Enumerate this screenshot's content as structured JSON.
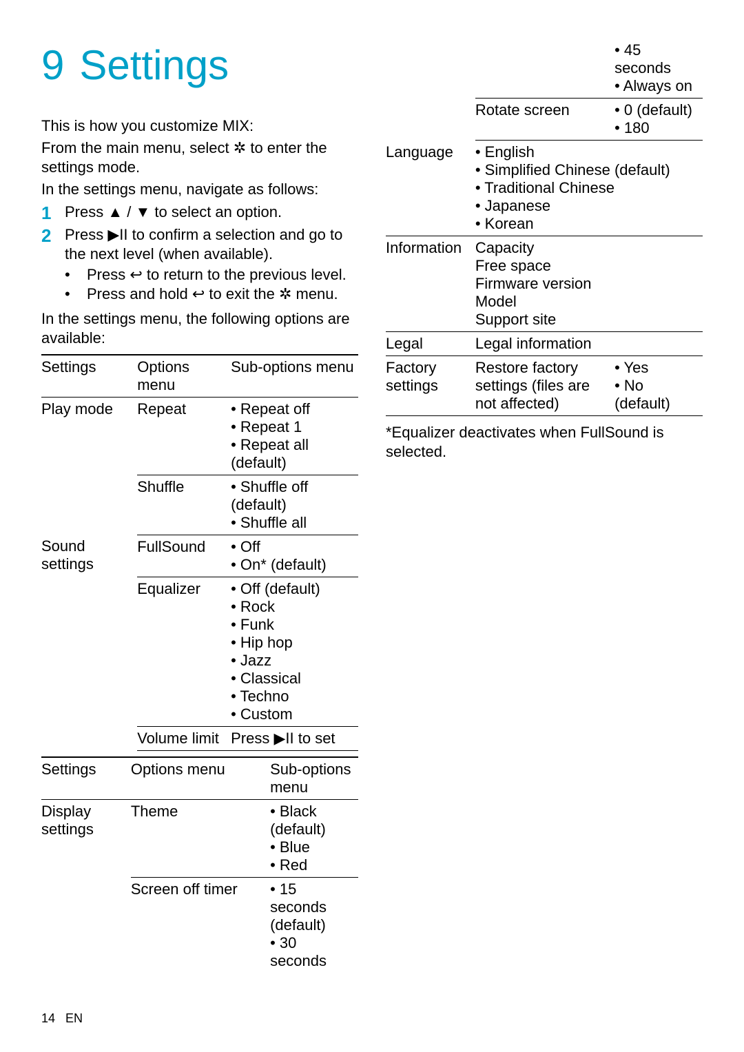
{
  "chapter_number": "9",
  "chapter_title": "Settings",
  "intro_line1": "This is how you customize MIX:",
  "intro_line2a": "From the main menu, select ",
  "intro_line2b": " to enter the settings mode.",
  "intro_line3": "In the settings menu, navigate as follows:",
  "step1_a": "Press ",
  "step1_b": " / ",
  "step1_c": " to select an option.",
  "step2_a": "Press ",
  "step2_b": " to confirm a selection and go to the next level (when available).",
  "sub1_a": "Press ",
  "sub1_b": " to return to the previous level.",
  "sub2_a": "Press and hold ",
  "sub2_b": " to exit the ",
  "sub2_c": " menu.",
  "avail_text": "In the settings menu, the following options are available:",
  "hdr_settings": "Settings",
  "hdr_options": "Options menu",
  "hdr_subopt": "Sub-options menu",
  "t1": {
    "play_mode": "Play mode",
    "repeat": "Repeat",
    "repeat_opts": [
      "Repeat off",
      "Repeat 1",
      "Repeat all (default)"
    ],
    "shuffle": "Shuffle",
    "shuffle_opts": [
      "Shuffle off (default)",
      "Shuffle all"
    ],
    "sound": "Sound settings",
    "fullsound": "FullSound",
    "fullsound_opts": [
      "Off",
      "On* (default)"
    ],
    "equalizer": "Equalizer",
    "equalizer_opts": [
      "Off (default)",
      "Rock",
      "Funk",
      "Hip hop",
      "Jazz",
      "Classical",
      "Techno",
      "Custom"
    ],
    "volume_limit": "Volume limit",
    "volume_limit_val_a": "Press ",
    "volume_limit_val_b": " to set"
  },
  "t2": {
    "display": "Display settings",
    "theme": "Theme",
    "theme_opts": [
      "Black (default)",
      "Blue",
      "Red"
    ],
    "screen_off": "Screen off timer",
    "screen_off_opts": [
      "15 seconds (default)",
      "30 seconds",
      "45 seconds",
      "Always on"
    ],
    "rotate": "Rotate screen",
    "rotate_opts": [
      "0  (default)",
      "180"
    ],
    "language": "Language",
    "language_opts": [
      "English",
      "Simplified Chinese (default)",
      "Traditional Chinese",
      "Japanese",
      "Korean"
    ],
    "information": "Information",
    "information_opts": [
      "Capacity",
      "Free space",
      "Firmware version",
      "Model",
      "Support site"
    ],
    "legal": "Legal",
    "legal_val": "Legal information",
    "factory": "Factory settings",
    "restore": "Restore factory settings (files are not affected)",
    "restore_opts": [
      "Yes",
      "No (default)"
    ]
  },
  "footnote": "*Equalizer deactivates when FullSound is selected.",
  "page_num": "14",
  "page_lang": "EN",
  "icons": {
    "gear": "✲",
    "up": "▲",
    "down": "▼",
    "play": "▶II",
    "back": "↩",
    "bullet": "•"
  }
}
